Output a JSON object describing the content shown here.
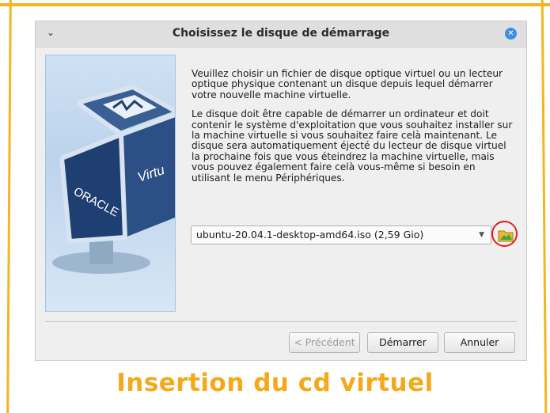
{
  "dialog": {
    "title": "Choisissez le disque de démarrage",
    "menu_icon": "chevron-down-icon",
    "close_icon": "close-icon",
    "paragraph1": "Veuillez choisir un fichier de disque optique virtuel ou un lecteur optique physique contenant un disque depuis lequel démarrer votre nouvelle machine virtuelle.",
    "paragraph2": "Le disque doit être capable de démarrer un ordinateur et doit contenir le système d'exploitation que vous souhaitez installer sur la machine virtuelle si vous souhaitez faire celà maintenant. Le disque sera automatiquement éjecté du lecteur de disque virtuel la prochaine fois que vous éteindrez la machine virtuelle, mais vous pouvez également faire celà vous-même si besoin en utilisant le menu Périphériques.",
    "selected_iso": "ubuntu-20.04.1-desktop-amd64.iso (2,59 Gio)",
    "buttons": {
      "previous": "< Précédent",
      "start": "Démarrer",
      "cancel": "Annuler"
    }
  },
  "illustration": {
    "brand_text": "ORACLE",
    "side_text": "Virtu"
  },
  "caption": "Insertion du cd virtuel",
  "colors": {
    "frame": "#f3b61f",
    "caption": "#f3a91a",
    "highlight_circle": "#e02020",
    "close_button": "#3d8fe0"
  }
}
